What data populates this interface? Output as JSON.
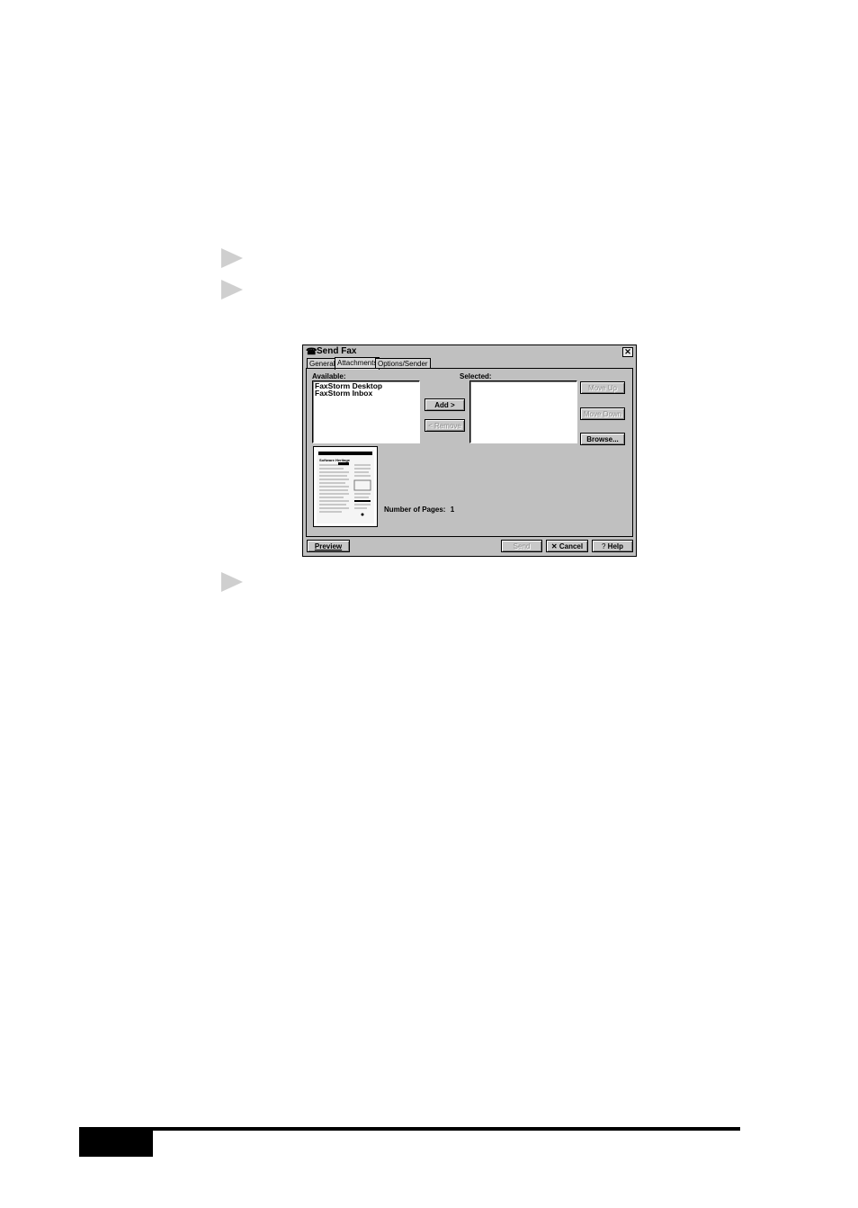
{
  "bullets": [
    "step-arrow-1",
    "step-arrow-2",
    "step-arrow-3"
  ],
  "dialog": {
    "title": "Send Fax",
    "close_glyph": "✕",
    "tabs": [
      "General",
      "Attachments",
      "Options/Sender"
    ],
    "active_tab": "Attachments",
    "available_label": "Available:",
    "selected_label": "Selected:",
    "available_items": [
      "FaxStorm Desktop",
      "FaxStorm Inbox"
    ],
    "add_label": "Add >",
    "remove_label": "< Remove",
    "move_up_label": "Move Up",
    "move_down_label": "Move Down",
    "browse_label": "Browse...",
    "pages_label": "Number of Pages:",
    "pages_value": "1",
    "preview_label": "Preview",
    "send_label": "Send",
    "cancel_label": "Cancel",
    "help_label": "Help",
    "cancel_icon": "✕",
    "help_icon": "?",
    "thumb_heading": "Software Heritage"
  }
}
